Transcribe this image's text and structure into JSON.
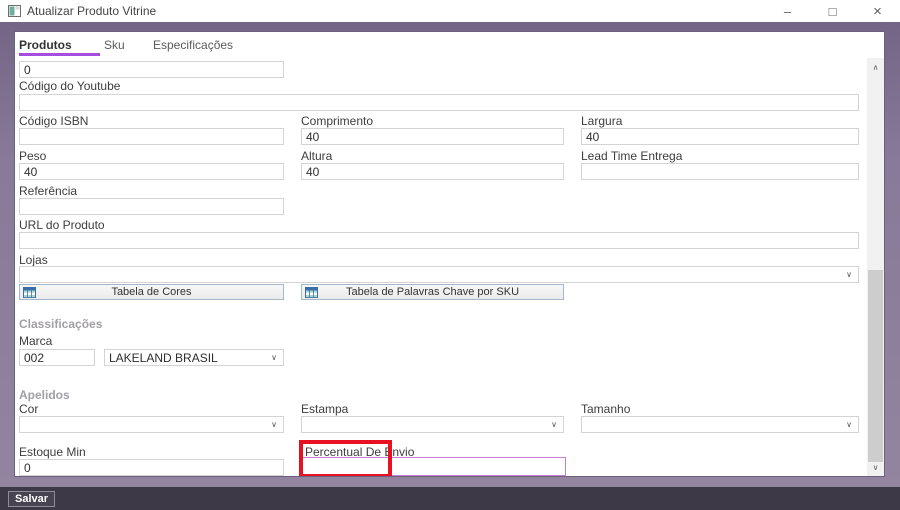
{
  "window": {
    "title": "Atualizar Produto Vitrine",
    "minimize_glyph": "–",
    "maximize_glyph": "□",
    "close_glyph": "×"
  },
  "tabs": [
    {
      "label": "Produtos"
    },
    {
      "label": "Sku"
    },
    {
      "label": "Especificações"
    }
  ],
  "active_tab": "Produtos",
  "form": {
    "top_partial_value": "0",
    "codigo_youtube": {
      "label": "Código do Youtube",
      "value": ""
    },
    "codigo_isbn": {
      "label": "Código ISBN",
      "value": ""
    },
    "comprimento": {
      "label": "Comprimento",
      "value": "40"
    },
    "largura": {
      "label": "Largura",
      "value": "40"
    },
    "peso": {
      "label": "Peso",
      "value": "40"
    },
    "altura": {
      "label": "Altura",
      "value": "40"
    },
    "lead_time_entrega": {
      "label": "Lead Time Entrega",
      "value": ""
    },
    "referencia": {
      "label": "Referência",
      "value": ""
    },
    "url_produto": {
      "label": "URL do Produto",
      "value": ""
    },
    "lojas": {
      "label": "Lojas",
      "value": ""
    },
    "estoque_min": {
      "label": "Estoque Min",
      "value": "0"
    },
    "percentual_envio": {
      "label": "Percentual De Envio",
      "value": ""
    }
  },
  "action_buttons": {
    "tabela_cores": "Tabela de Cores",
    "tabela_palavras": "Tabela de Palavras Chave por SKU"
  },
  "sections": {
    "classificacoes": {
      "title": "Classificações",
      "marca": {
        "label": "Marca",
        "code": "002",
        "name": "LAKELAND BRASIL"
      }
    },
    "apelidos": {
      "title": "Apelidos",
      "cor_label": "Cor",
      "estampa_label": "Estampa",
      "tamanho_label": "Tamanho"
    }
  },
  "footer": {
    "save_label": "Salvar"
  },
  "icons": {
    "chevron_down": "∨",
    "scroll_up": "∧",
    "scroll_down": "∨"
  },
  "colors": {
    "frame_purple": "#8a7c9a",
    "tab_underline": "#a64ce0",
    "focus_border": "#c77fd4",
    "highlight_red": "#e81123",
    "footer_bar": "#3e3947"
  }
}
